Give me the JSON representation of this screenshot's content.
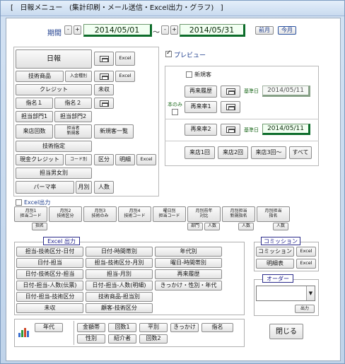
{
  "window": {
    "title": "[   日報メニュー   (集計印刷・メール送信・Excel出力・グラフ)   ]"
  },
  "period": {
    "label": "期間",
    "from": "2014/05/01",
    "to": "2014/05/31",
    "sep": "～",
    "minus": "-",
    "plus": "+",
    "prev_month": "前月",
    "this_month": "今月"
  },
  "left_buttons": {
    "nippo": "日報",
    "excel": "Excel",
    "gijutsu_shohin": "技術商品",
    "nyukin": "入金種別",
    "credit": "クレジット",
    "mishu": "未収",
    "shimei1": "指名１",
    "shimei2": "指名２",
    "tanto_bumon1": "担当部門1",
    "tanto_bumon2": "担当部門2",
    "raiten_kaisu": "来店回数",
    "tanto_shinki": "担当者\n新規客",
    "shinki_ichiran": "新規客一覧",
    "gijutsu_shitei": "技術指定",
    "genkin_credit": "現金クレジット",
    "code_betsu": "コード別",
    "kubun": "区分",
    "meisai": "明細",
    "tanto_danjo": "担当男女別",
    "perma": "パーマ率",
    "tsukibetsu": "月別",
    "ninzu": "人数"
  },
  "preview": {
    "label": "プレビュー",
    "checked": true
  },
  "right_panel": {
    "shinki_label": "新規客",
    "sairai_rireki": "再来履歴",
    "sairai1": "再来率1",
    "sairai2": "再来率2",
    "kijunbi_label": "基準日",
    "kijunbi1": "2014/05/11",
    "kijunbi2": "2014/05/11",
    "kon_nomi": "本のみ",
    "raiten1": "来店1回",
    "raiten2": "来店2回",
    "raiten3": "来店3回～",
    "subete": "すべて"
  },
  "excel_out": {
    "label": "Excel出力",
    "buttons": [
      "月別1\n担当コード",
      "月別2\n技術区分",
      "月別3\n技術のみ",
      "月別4\n技術コード",
      "曜日別\n担当コード",
      "月別前年\n対比",
      "月別担当\n新規指名",
      "月別担当\n指名"
    ],
    "sub_shimei": "指名",
    "sub_bumon": "部門",
    "sub_ninzu": "人数",
    "sub_ninzu2": "人数",
    "sub_ninzu3": "人数"
  },
  "excel_group": {
    "title": "Excel 出力",
    "col1": [
      "担当-技術区分-日付",
      "日付-担当",
      "日付-技術区分-担当",
      "日付-担当-人数(伝票)",
      "日付-担当-技術区分",
      "未収"
    ],
    "col2": [
      "日付-時間帯別",
      "担当-技術区分-月別",
      "担当-月別",
      "日付-担当-人数(明細)",
      "技術商品-担当別",
      "顧客-技術区分"
    ],
    "col3": [
      "年代別",
      "曜日-時間帯別",
      "再来履歴",
      "きっかけ・性別・年代"
    ]
  },
  "commission": {
    "title": "コミッション",
    "commission": "コミッション",
    "meisai_hyo": "明細表",
    "excel": "Excel"
  },
  "order": {
    "title": "オーダー",
    "output": "出力",
    "value": ""
  },
  "graph": {
    "nendai": "年代",
    "row1": [
      "金額帯",
      "回数1",
      "平別",
      "きっかけ",
      "指名"
    ],
    "row2": [
      "性別",
      "紹介者",
      "回数2"
    ],
    "close": "閉じる"
  },
  "colors": {
    "accent_green": "#0c6c2a",
    "accent_blue": "#1c1c8c",
    "panel_bg": "#c7d8ec"
  }
}
